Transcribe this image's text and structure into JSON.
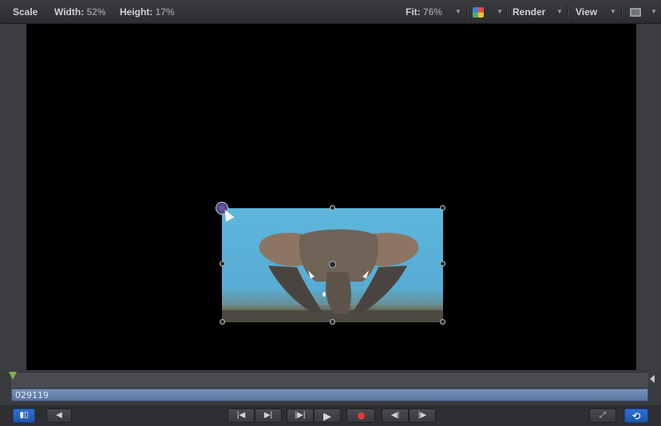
{
  "status_bar": {
    "tool": "Scale",
    "width_label": "Width:",
    "width_value": "52%",
    "height_label": "Height:",
    "height_value": "17%",
    "fit_label": "Fit:",
    "fit_value": "76%",
    "render_label": "Render",
    "view_label": "View"
  },
  "timeline": {
    "clip_name": "029119"
  },
  "icons": {
    "color_channel": "color-swatch-icon",
    "layout": "grid-layout-icon",
    "play_range": "play-range-icon",
    "audio": "speaker-icon",
    "go_start": "go-to-start-icon",
    "step_back": "step-back-icon",
    "step_forward": "step-forward-icon",
    "play": "play-icon",
    "record": "record-icon",
    "prev_keyframe": "previous-keyframe-icon",
    "next_keyframe": "next-keyframe-icon",
    "fullscreen": "fullscreen-icon",
    "loop": "loop-icon"
  },
  "colors": {
    "accent_blue": "#2f6fd0",
    "record_red": "#e33a36",
    "playhead_green": "#7fb24a",
    "clip_bar": "#6a84ad"
  }
}
